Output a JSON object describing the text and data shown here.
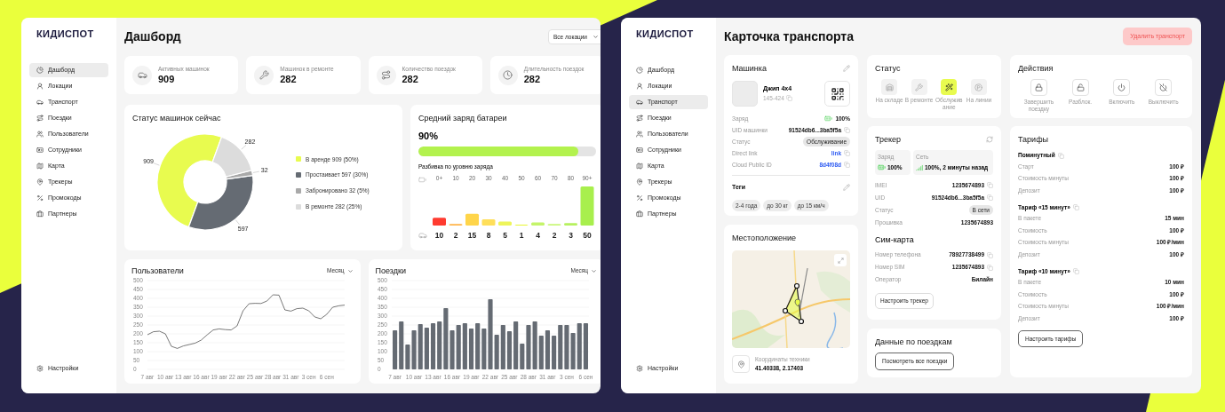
{
  "dashboard": {
    "logo": "КИДИСПОТ",
    "nav": [
      {
        "label": "Дашборд",
        "selected": true
      },
      {
        "label": "Локации",
        "selected": false
      },
      {
        "label": "Транспорт",
        "selected": false
      },
      {
        "label": "Поездки",
        "selected": false
      },
      {
        "label": "Пользователи",
        "selected": false
      },
      {
        "label": "Сотрудники",
        "selected": false
      },
      {
        "label": "Карта",
        "selected": false
      },
      {
        "label": "Трекеры",
        "selected": false
      },
      {
        "label": "Промокоды",
        "selected": false
      },
      {
        "label": "Партнеры",
        "selected": false
      }
    ],
    "settings": "Настройки",
    "title": "Дашборд",
    "location_filter": "Все локации",
    "stats": [
      {
        "label": "Активных машинок",
        "value": "909"
      },
      {
        "label": "Машинок в ремонте",
        "value": "282"
      },
      {
        "label": "Количество поездок",
        "value": "282"
      },
      {
        "label": "Длительность поездок",
        "value": "282"
      }
    ],
    "status_card": {
      "title": "Статус машинок сейчас",
      "chart_data": {
        "type": "donut",
        "values": [
          909,
          597,
          32,
          282
        ],
        "colors": [
          "#e8fb4f",
          "#656b73",
          "#a9a9a9",
          "#dcdcdc"
        ],
        "data_labels": true
      },
      "legend": [
        {
          "label": "В аренде 909 (50%)",
          "color": "#e8fb4f"
        },
        {
          "label": "Простаивает 597 (30%)",
          "color": "#656b73"
        },
        {
          "label": "Забронировано 32 (5%)",
          "color": "#a9a9a9"
        },
        {
          "label": "В ремонте 282 (25%)",
          "color": "#dcdcdc"
        }
      ]
    },
    "battery_card": {
      "title": "Средний заряд батареи",
      "reading": "90%",
      "level": 0.9,
      "breakdown_title": "Разбивка по уровню заряда",
      "chart_data": {
        "type": "bar",
        "categories": [
          "0+",
          "10",
          "20",
          "30",
          "40",
          "50",
          "60",
          "70",
          "80",
          "90+"
        ],
        "values": [
          10,
          2,
          15,
          8,
          5,
          1,
          4,
          2,
          3,
          50
        ],
        "colors": [
          "#ff3b30",
          "#ffb44a",
          "#ffd54a",
          "#ffdf5a",
          "#eef55a",
          "#e8f531",
          "#c4f46a",
          "#c9f77a",
          "#b6f15f",
          "#a8ef4d"
        ],
        "data_labels": true
      }
    },
    "users_card": {
      "title": "Пользователи",
      "period": "Месяц",
      "chart_data": {
        "type": "line",
        "categories": [
          "7 авг",
          null,
          null,
          "10 авг",
          null,
          null,
          "13 авг",
          null,
          null,
          "16 авг",
          null,
          null,
          "19 авг",
          null,
          null,
          "22 авг",
          null,
          null,
          "25 авг",
          null,
          null,
          "28 авг",
          null,
          null,
          "31 авг",
          null,
          null,
          "3 сен",
          null,
          null,
          "6 сен",
          null,
          null,
          null
        ],
        "series": [
          {
            "color": "#555555",
            "values": [
              195,
              212,
              215,
              200,
              130,
              118,
              132,
              140,
              148,
              165,
              195,
              222,
              228,
              224,
              222,
              245,
              330,
              370,
              372,
              371,
              385,
              420,
              418,
              335,
              328,
              342,
              345,
              330,
              295,
              285,
              310,
              350,
              358,
              362
            ]
          }
        ],
        "ylim": [
          0,
          500
        ],
        "yticks": [
          0,
          50,
          100,
          150,
          200,
          250,
          300,
          350,
          400,
          450,
          500
        ]
      }
    },
    "trips_card": {
      "title": "Поездки",
      "period": "Месяц",
      "chart_data": {
        "type": "bar",
        "categories": [
          "7 авг",
          null,
          null,
          "10 авг",
          null,
          null,
          "13 авг",
          null,
          null,
          "16 авг",
          null,
          null,
          "19 авг",
          null,
          null,
          "22 авг",
          null,
          null,
          "25 авг",
          null,
          null,
          "28 авг",
          null,
          null,
          "31 авг",
          null,
          null,
          "3 сен",
          null,
          null,
          "6 сен"
        ],
        "series": [
          {
            "color": "#656b73",
            "values": [
              220,
              270,
              140,
              220,
              255,
              235,
              260,
              270,
              345,
              220,
              250,
              260,
              230,
              260,
              230,
              395,
              195,
              250,
              215,
              270,
              145,
              250,
              270,
              190,
              220,
              190,
              250,
              250,
              205,
              260,
              260
            ]
          }
        ],
        "ylim": [
          0,
          500
        ],
        "yticks": [
          0,
          50,
          100,
          150,
          200,
          250,
          300,
          350,
          400,
          450,
          500
        ]
      }
    }
  },
  "vehicle": {
    "logo": "КИДИСПОТ",
    "nav": [
      {
        "label": "Дашборд",
        "selected": false
      },
      {
        "label": "Локации",
        "selected": false
      },
      {
        "label": "Транспорт",
        "selected": true
      },
      {
        "label": "Поездки",
        "selected": false
      },
      {
        "label": "Пользователи",
        "selected": false
      },
      {
        "label": "Сотрудники",
        "selected": false
      },
      {
        "label": "Карта",
        "selected": false
      },
      {
        "label": "Трекеры",
        "selected": false
      },
      {
        "label": "Промокоды",
        "selected": false
      },
      {
        "label": "Партнеры",
        "selected": false
      }
    ],
    "settings": "Настройки",
    "title": "Карточка транспорта",
    "delete_button": "Удалить транспорт",
    "car_card": {
      "title": "Машинка",
      "name": "Джип 4x4",
      "number": "145-424",
      "fields": [
        {
          "label": "Заряд",
          "value": "100%",
          "kind": "battery"
        },
        {
          "label": "UID машинки",
          "value": "91524db6...3ba5f5a",
          "kind": "copy"
        },
        {
          "label": "Статус",
          "value": "Обслуживание",
          "kind": "badge"
        },
        {
          "label": "Direct link",
          "value": "link",
          "kind": "link"
        },
        {
          "label": "Cloud Public ID",
          "value": "8d4f08d",
          "kind": "link"
        }
      ],
      "tags_title": "Теги",
      "tags": [
        "2-4 года",
        "до 30 кг",
        "до 15 км/ч"
      ]
    },
    "location_card": {
      "title": "Местоположение",
      "coords_label": "Координаты техники",
      "coords": "41.40338, 2.17403"
    },
    "status_card": {
      "title": "Статус",
      "options": [
        {
          "label": "На складе",
          "selected": false
        },
        {
          "label": "В ремонте",
          "selected": false
        },
        {
          "label": "Обслуживание",
          "selected": true
        },
        {
          "label": "На линии",
          "selected": false
        }
      ]
    },
    "tracker_card": {
      "title": "Трекер",
      "charge_label": "Заряд",
      "charge": "100%",
      "network_label": "Сеть",
      "network": "100%, 2 минуты назад",
      "fields": [
        {
          "label": "IMEI",
          "value": "1235674893",
          "kind": "copy"
        },
        {
          "label": "UID",
          "value": "91524db6...3ba5f5a",
          "kind": "copy"
        },
        {
          "label": "Статус",
          "value": "В сети",
          "kind": "badge"
        },
        {
          "label": "Прошивка",
          "value": "1235674893",
          "kind": "plain"
        }
      ],
      "sim_title": "Сим-карта",
      "sim_fields": [
        {
          "label": "Номер телефона",
          "value": "78927738499",
          "kind": "copy"
        },
        {
          "label": "Номер SIM",
          "value": "1235674893",
          "kind": "copy"
        },
        {
          "label": "Оператор",
          "value": "Билайн",
          "kind": "plain"
        }
      ],
      "button": "Настроить трекер"
    },
    "trips_card": {
      "title": "Данные по поездкам",
      "button": "Посмотреть все поездки"
    },
    "actions_card": {
      "title": "Действия",
      "actions": [
        "Завершить поездку",
        "Разблок.",
        "Включить",
        "Выключить"
      ]
    },
    "tariffs_card": {
      "title": "Тарифы",
      "tariffs": [
        {
          "name": "Поминутный",
          "rows": [
            {
              "label": "Старт",
              "value": "100 ₽"
            },
            {
              "label": "Стоимость минуты",
              "value": "100 ₽"
            },
            {
              "label": "Депозит",
              "value": "100 ₽"
            }
          ]
        },
        {
          "name": "Тариф «15 минут»",
          "rows": [
            {
              "label": "В пакете",
              "value": "15 мин"
            },
            {
              "label": "Стоимость",
              "value": "100 ₽"
            },
            {
              "label": "Стоимость минуты",
              "value": "100 ₽/мин"
            },
            {
              "label": "Депозит",
              "value": "100 ₽"
            }
          ]
        },
        {
          "name": "Тариф «10 минут»",
          "rows": [
            {
              "label": "В пакете",
              "value": "10 мин"
            },
            {
              "label": "Стоимость",
              "value": "100 ₽"
            },
            {
              "label": "Стоимость минуты",
              "value": "100 ₽/мин"
            },
            {
              "label": "Депозит",
              "value": "100 ₽"
            }
          ]
        }
      ],
      "button": "Настроить тарифы"
    }
  }
}
